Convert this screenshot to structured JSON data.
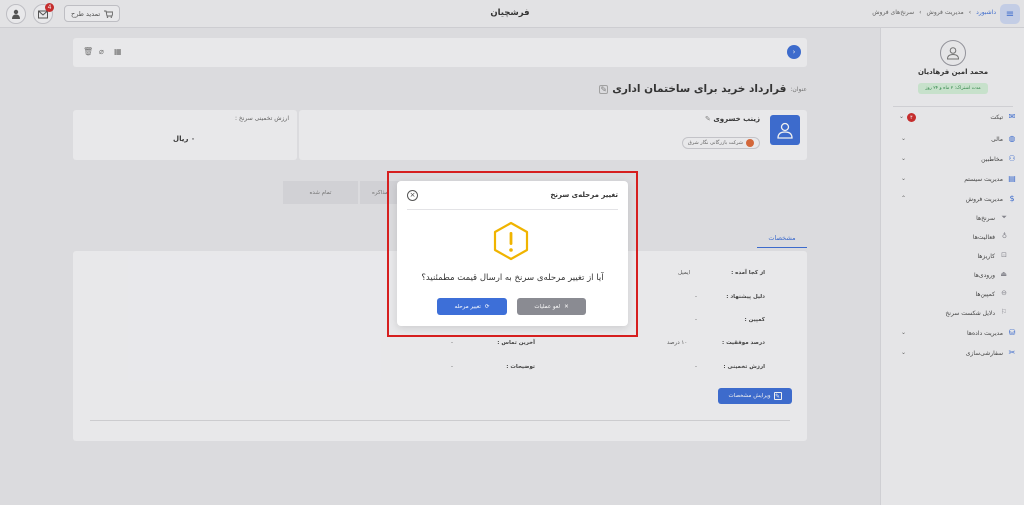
{
  "topbar": {
    "app_title": "فرشچیان",
    "design_button": "تمدید طرح",
    "notification_count": "4",
    "breadcrumb": [
      "داشبورد",
      "مدیریت فروش",
      "سرنخ‌های فروش"
    ],
    "breadcrumb_sep": "›",
    "menu_icon": "menu-icon"
  },
  "sidebar": {
    "profile_name": "محمد امین فرهادیان",
    "profile_tag": "مدت اشتراک: ۲ ماه و ۲۴ روز",
    "items": [
      {
        "label": "تیکت",
        "icon": "ticket-icon",
        "badge": "۴"
      },
      {
        "label": "مالی",
        "icon": "finance-icon"
      },
      {
        "label": "مخاطبین",
        "icon": "contacts-icon"
      },
      {
        "label": "مدیریت سیستم",
        "icon": "system-icon"
      },
      {
        "label": "مدیریت فروش",
        "icon": "sales-icon"
      }
    ],
    "sub_items": [
      {
        "label": "سرنخ‌ها"
      },
      {
        "label": "فعالیت‌ها"
      },
      {
        "label": "کاریزها"
      },
      {
        "label": "ورودی‌ها"
      },
      {
        "label": "کمپین‌ها"
      },
      {
        "label": "دلایل شکست سرنخ"
      }
    ],
    "more_items": [
      {
        "label": "مدیریت داده‌ها"
      },
      {
        "label": "سفارشی‌سازی"
      }
    ]
  },
  "main": {
    "title_label": "عنوان:",
    "title_value": "قرارداد خرید برای ساختمان اداری",
    "contact": {
      "name": "زینب خسروی",
      "company": "شرکت بازرگانی نگار شرق"
    },
    "estimate": {
      "label": "ارزش تخمینی سرنخ :",
      "value": "۰ ریال"
    },
    "stages": [
      "تمام شده",
      "مذاکره"
    ],
    "tab_specs": "مشخصات",
    "details": {
      "source_label": "از کجا آمده :",
      "source_value": "ایمیل",
      "reason_label": "دلیل پیشنهاد :",
      "reason_value": "-",
      "campaign_label": "کمپین :",
      "campaign_value": "-",
      "success_label": "درصد موفقیت :",
      "success_value": "۱۰ درصد",
      "estimate_label": "ارزش تخمینی :",
      "estimate_value": "-",
      "last_contact_label": "آخرین تماس :",
      "last_contact_value": "-",
      "notes_label": "توضیحات :",
      "notes_value": "-"
    },
    "edit_specs_button": "ویرایش مشخصات"
  },
  "modal": {
    "title": "تغییر مرحله‌ی سرنخ",
    "question": "آیا از تغییر مرحله‌ی سرنخ به ارسال قیمت مطمئنید؟",
    "confirm_button": "تغییر مرحله",
    "cancel_button": "لغو عملیات",
    "close_glyph": "×",
    "confirm_glyph": "⟳",
    "cancel_glyph": "✕"
  },
  "colors": {
    "accent": "#3d6fd8",
    "highlight": "#d61f1f",
    "warning": "#f0b400",
    "badge": "#d12c2c"
  }
}
